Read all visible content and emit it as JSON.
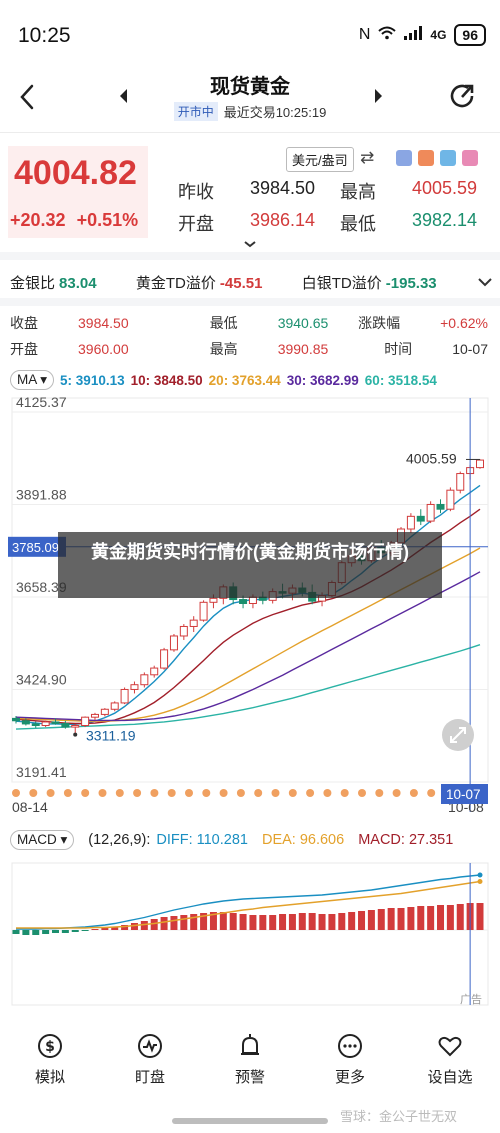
{
  "status_bar": {
    "time": "10:25",
    "signal": "4G",
    "battery": "96"
  },
  "header": {
    "title": "现货黄金",
    "market_status": "开市中",
    "last_trade": "最近交易10:25:19"
  },
  "quote": {
    "price": "4004.82",
    "change": "+20.32",
    "change_pct": "+0.51%",
    "unit_select": "美元/盎司",
    "prev_close_label": "昨收",
    "prev_close": "3984.50",
    "open_label": "开盘",
    "open": "3986.14",
    "high_label": "最高",
    "high": "4005.59",
    "low_label": "最低",
    "low": "3982.14"
  },
  "indicators": [
    {
      "label": "金银比",
      "value": "83.04"
    },
    {
      "label": "黄金TD溢价",
      "value": "-45.51"
    },
    {
      "label": "白银TD溢价",
      "value": "-195.33"
    }
  ],
  "summary": {
    "close_label": "收盘",
    "close": "3984.50",
    "low_label": "最低",
    "low": "3940.65",
    "chg_label": "涨跌幅",
    "chg": "+0.62%",
    "open_label": "开盘",
    "open": "3960.00",
    "high_label": "最高",
    "high": "3990.85",
    "time_label": "时间",
    "time": "10-07"
  },
  "ma": {
    "selector": "MA",
    "items": [
      {
        "text": "5: 3910.13",
        "color": "#1a8fc2"
      },
      {
        "text": "10: 3848.50",
        "color": "#a11f2a"
      },
      {
        "text": "20: 3763.44",
        "color": "#e3a12b"
      },
      {
        "text": "30: 3682.99",
        "color": "#5a2a9e"
      },
      {
        "text": "60: 3518.54",
        "color": "#2bb3a5"
      }
    ]
  },
  "main_chart": {
    "y_ticks": [
      "4125.37",
      "3891.88",
      "3658.39",
      "3424.90",
      "3191.41"
    ],
    "y_tick_values": [
      4125.37,
      3891.88,
      3658.39,
      3424.9,
      3191.41
    ],
    "crosshair_price": "3785.09",
    "crosshair_value": 3785.09,
    "max_label": "4005.59",
    "min_label": "3311.19",
    "date_start": "08-14",
    "date_end": "10-08",
    "crosshair_date": "10-07",
    "candles": [
      [
        3352,
        3358,
        3339,
        3346
      ],
      [
        3346,
        3352,
        3334,
        3338
      ],
      [
        3338,
        3344,
        3328,
        3334
      ],
      [
        3334,
        3346,
        3330,
        3343
      ],
      [
        3343,
        3352,
        3336,
        3339
      ],
      [
        3339,
        3346,
        3326,
        3330
      ],
      [
        3330,
        3338,
        3311,
        3334
      ],
      [
        3334,
        3357,
        3330,
        3355
      ],
      [
        3355,
        3366,
        3348,
        3362
      ],
      [
        3362,
        3378,
        3357,
        3375
      ],
      [
        3375,
        3395,
        3370,
        3391
      ],
      [
        3391,
        3430,
        3388,
        3425
      ],
      [
        3425,
        3445,
        3415,
        3437
      ],
      [
        3437,
        3468,
        3430,
        3462
      ],
      [
        3462,
        3485,
        3455,
        3479
      ],
      [
        3479,
        3530,
        3475,
        3525
      ],
      [
        3525,
        3565,
        3520,
        3560
      ],
      [
        3560,
        3590,
        3550,
        3584
      ],
      [
        3584,
        3610,
        3570,
        3600
      ],
      [
        3600,
        3650,
        3596,
        3645
      ],
      [
        3645,
        3665,
        3630,
        3655
      ],
      [
        3655,
        3690,
        3640,
        3684
      ],
      [
        3684,
        3695,
        3640,
        3652
      ],
      [
        3652,
        3662,
        3630,
        3642
      ],
      [
        3642,
        3665,
        3630,
        3658
      ],
      [
        3658,
        3672,
        3640,
        3650
      ],
      [
        3650,
        3680,
        3642,
        3672
      ],
      [
        3672,
        3692,
        3655,
        3668
      ],
      [
        3668,
        3690,
        3650,
        3681
      ],
      [
        3681,
        3695,
        3660,
        3670
      ],
      [
        3670,
        3690,
        3640,
        3648
      ],
      [
        3648,
        3670,
        3635,
        3662
      ],
      [
        3662,
        3700,
        3658,
        3695
      ],
      [
        3695,
        3750,
        3690,
        3745
      ],
      [
        3745,
        3778,
        3735,
        3762
      ],
      [
        3762,
        3782,
        3740,
        3750
      ],
      [
        3750,
        3790,
        3745,
        3784
      ],
      [
        3784,
        3802,
        3760,
        3770
      ],
      [
        3770,
        3800,
        3762,
        3795
      ],
      [
        3795,
        3835,
        3790,
        3830
      ],
      [
        3830,
        3870,
        3820,
        3862
      ],
      [
        3862,
        3880,
        3840,
        3850
      ],
      [
        3850,
        3900,
        3845,
        3892
      ],
      [
        3892,
        3905,
        3870,
        3880
      ],
      [
        3880,
        3935,
        3875,
        3928
      ],
      [
        3928,
        3975,
        3920,
        3970
      ],
      [
        3970,
        3992,
        3955,
        3985
      ],
      [
        3985,
        4006,
        3982,
        4004
      ]
    ],
    "ma_series": {
      "ma5": [
        3345,
        3343,
        3340,
        3338,
        3338,
        3337,
        3337,
        3340,
        3345,
        3354,
        3365,
        3382,
        3402,
        3423,
        3445,
        3470,
        3498,
        3528,
        3556,
        3585,
        3610,
        3630,
        3643,
        3648,
        3652,
        3652,
        3655,
        3660,
        3664,
        3668,
        3665,
        3662,
        3665,
        3680,
        3700,
        3718,
        3740,
        3758,
        3772,
        3788,
        3810,
        3830,
        3850,
        3865,
        3885,
        3905,
        3922,
        3940
      ],
      "ma10": [
        3350,
        3348,
        3346,
        3344,
        3342,
        3340,
        3339,
        3339,
        3340,
        3343,
        3348,
        3356,
        3366,
        3378,
        3392,
        3410,
        3430,
        3452,
        3475,
        3498,
        3522,
        3544,
        3562,
        3577,
        3592,
        3604,
        3614,
        3622,
        3630,
        3638,
        3643,
        3648,
        3654,
        3662,
        3672,
        3684,
        3698,
        3712,
        3726,
        3742,
        3760,
        3778,
        3796,
        3812,
        3828,
        3846,
        3862,
        3880
      ],
      "ma20": [
        3352,
        3351,
        3350,
        3349,
        3348,
        3347,
        3346,
        3345,
        3345,
        3345,
        3346,
        3348,
        3351,
        3355,
        3360,
        3367,
        3375,
        3385,
        3396,
        3408,
        3421,
        3435,
        3449,
        3463,
        3477,
        3491,
        3505,
        3519,
        3533,
        3547,
        3560,
        3573,
        3586,
        3599,
        3612,
        3625,
        3638,
        3651,
        3664,
        3677,
        3690,
        3703,
        3716,
        3729,
        3742,
        3755,
        3768,
        3782
      ],
      "ma30": [
        3355,
        3354,
        3353,
        3352,
        3351,
        3350,
        3349,
        3348,
        3347,
        3347,
        3347,
        3347,
        3348,
        3349,
        3351,
        3354,
        3358,
        3363,
        3369,
        3376,
        3384,
        3393,
        3403,
        3414,
        3425,
        3437,
        3449,
        3461,
        3474,
        3487,
        3500,
        3513,
        3526,
        3539,
        3552,
        3565,
        3578,
        3591,
        3604,
        3617,
        3630,
        3643,
        3656,
        3669,
        3682,
        3695,
        3708,
        3722
      ],
      "ma60": [
        3325,
        3326,
        3327,
        3328,
        3329,
        3330,
        3331,
        3332,
        3333,
        3334,
        3335,
        3336,
        3337,
        3339,
        3341,
        3343,
        3346,
        3349,
        3352,
        3356,
        3360,
        3364,
        3369,
        3374,
        3379,
        3385,
        3391,
        3397,
        3403,
        3410,
        3417,
        3424,
        3431,
        3438,
        3445,
        3452,
        3459,
        3466,
        3473,
        3480,
        3487,
        3494,
        3501,
        3508,
        3515,
        3522,
        3530,
        3538
      ]
    }
  },
  "overlay_caption": "黄金期货实时行情价(黄金期货市场行情)",
  "macd": {
    "selector": "MACD",
    "params": "(12,26,9):",
    "diff_text": "DIFF: 110.281",
    "dea_text": "DEA: 96.606",
    "macd_text": "MACD: 27.351",
    "diff_color": "#1a8fc2",
    "dea_color": "#e3a12b",
    "macd_color": "#a11f2a",
    "ad_tag": "广告",
    "bars": [
      -4,
      -5,
      -5,
      -4,
      -3,
      -3,
      -2,
      -1,
      1,
      2,
      3,
      5,
      7,
      9,
      11,
      13,
      14,
      15,
      16,
      17,
      18,
      18,
      17,
      16,
      15,
      15,
      15,
      16,
      16,
      17,
      17,
      16,
      16,
      17,
      18,
      19,
      20,
      21,
      22,
      22,
      23,
      24,
      24,
      25,
      25,
      26,
      27,
      27
    ],
    "diff": [
      2,
      2,
      2,
      3,
      3,
      4,
      5,
      6,
      8,
      10,
      13,
      17,
      21,
      25,
      30,
      35,
      40,
      44,
      48,
      52,
      55,
      58,
      60,
      62,
      63,
      64,
      65,
      66,
      67,
      68,
      69,
      70,
      72,
      74,
      76,
      78,
      80,
      83,
      86,
      89,
      92,
      95,
      98,
      101,
      103,
      106,
      108,
      110
    ],
    "dea": [
      4,
      4,
      4,
      4,
      4,
      4,
      4,
      4,
      5,
      5,
      6,
      7,
      9,
      11,
      13,
      16,
      19,
      22,
      25,
      28,
      31,
      34,
      37,
      40,
      42,
      45,
      47,
      49,
      51,
      53,
      55,
      57,
      59,
      61,
      63,
      65,
      67,
      69,
      71,
      73,
      76,
      79,
      82,
      85,
      88,
      91,
      94,
      97
    ]
  },
  "bottom_nav": [
    {
      "label": "模拟",
      "icon": "dollar-cycle-icon"
    },
    {
      "label": "盯盘",
      "icon": "pulse-icon"
    },
    {
      "label": "预警",
      "icon": "bell-icon"
    },
    {
      "label": "更多",
      "icon": "more-icon"
    },
    {
      "label": "设自选",
      "icon": "heart-icon"
    }
  ],
  "watermark": "雪球：金公子世无双"
}
